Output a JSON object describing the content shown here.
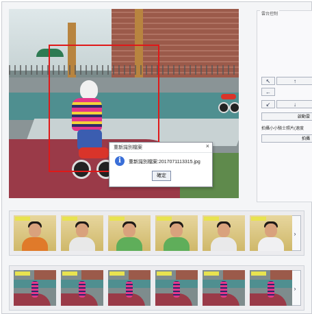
{
  "video": {
    "detection_box_color": "#e01818"
  },
  "dialog": {
    "title": "重新識別檔案",
    "message": "重新識別檔案:2017071113315.jpg",
    "ok_label": "確定",
    "close_label": "×",
    "icon": "info-icon"
  },
  "control_panel": {
    "title": "雲台控制",
    "arrows": {
      "up_left": "↖",
      "up": "↑",
      "left": "←",
      "down_left": "↙",
      "down": "↓"
    },
    "button1": "啟動雲",
    "label": "拍攝小小騎士照片(速度",
    "button2": "拍攝"
  },
  "strip1": {
    "next_label": "›",
    "shirts": [
      "#e07a2a",
      "#e8e8e8",
      "#5fae5a",
      "#5fae5a",
      "#e9e9ea",
      "#f0f0f2"
    ],
    "count": 6
  },
  "strip2": {
    "next_label": "›",
    "count": 6
  }
}
